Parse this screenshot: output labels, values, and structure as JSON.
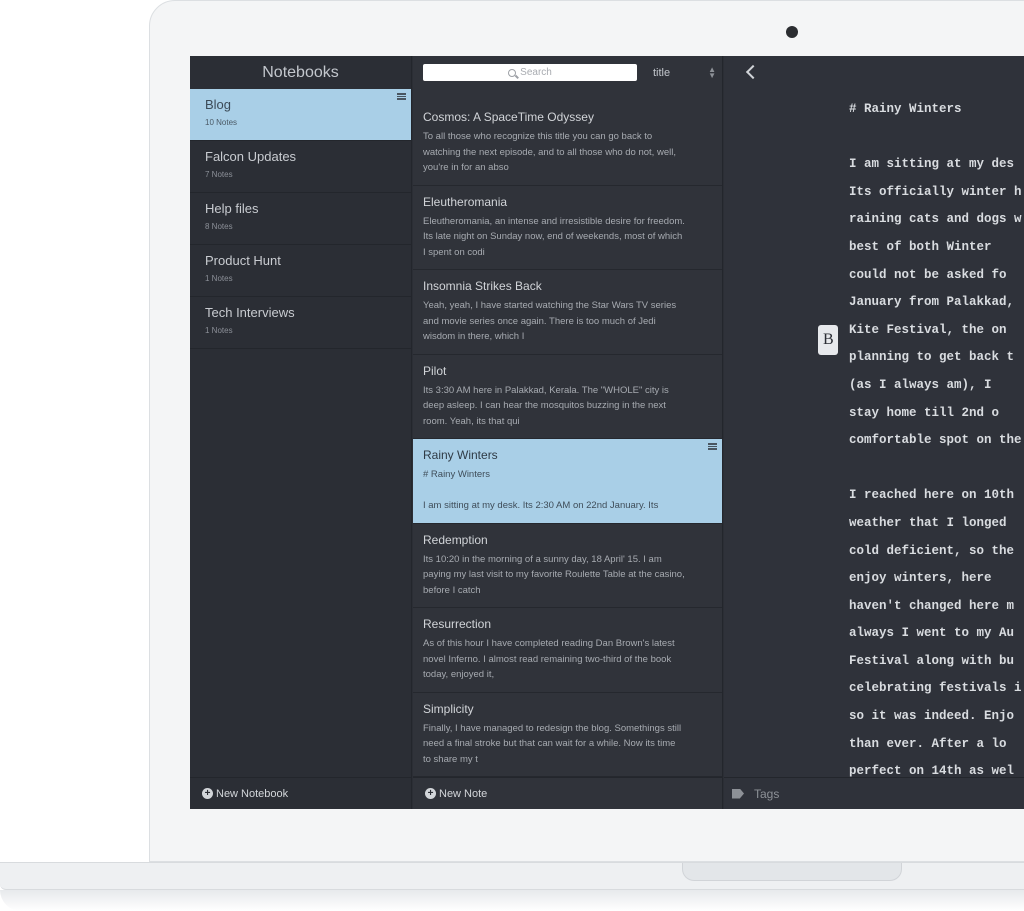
{
  "notebooks": {
    "header": "Notebooks",
    "items": [
      {
        "name": "Blog",
        "count": "10 Notes",
        "active": true
      },
      {
        "name": "Falcon Updates",
        "count": "7 Notes",
        "active": false
      },
      {
        "name": "Help files",
        "count": "8 Notes",
        "active": false
      },
      {
        "name": "Product Hunt",
        "count": "1 Notes",
        "active": false
      },
      {
        "name": "Tech Interviews",
        "count": "1 Notes",
        "active": false
      }
    ],
    "footer": "New Notebook"
  },
  "notes": {
    "search_placeholder": "Search",
    "sort_label": "title",
    "items": [
      {
        "title": "Cosmos: A SpaceTime Odyssey",
        "excerpt": "To all those who recognize this title you can go back to\nwatching the next episode, and to all those who do not, well,\nyou're in for an abso",
        "active": false
      },
      {
        "title": "Eleutheromania",
        "excerpt": "Eleutheromania, an intense and irresistible desire for freedom.\nIts late night on Sunday now, end of weekends, most of which\nI spent on codi",
        "active": false
      },
      {
        "title": "Insomnia Strikes Back",
        "excerpt": "Yeah, yeah, I have started watching the Star Wars TV series\nand movie series once again. There is too much of Jedi\nwisdom in there, which I",
        "active": false
      },
      {
        "title": "Pilot",
        "excerpt": "Its 3:30 AM here in Palakkad, Kerala. The \"WHOLE\" city is\ndeep asleep. I can hear the mosquitos buzzing in the next\nroom. Yeah, its that qui",
        "active": false
      },
      {
        "title": "Rainy Winters",
        "excerpt": "# Rainy Winters\n\nI am sitting at my desk. Its 2:30 AM on 22nd January. Its",
        "active": true
      },
      {
        "title": "Redemption",
        "excerpt": "Its 10:20 in the morning of a sunny day, 18 April' 15. I am\npaying my last visit to my favorite Roulette Table at the casino,\nbefore I catch",
        "active": false
      },
      {
        "title": "Resurrection",
        "excerpt": "As of this hour I have completed reading Dan Brown's latest\nnovel Inferno. I almost read remaining two-third of the book\ntoday, enjoyed it,",
        "active": false
      },
      {
        "title": "Simplicity",
        "excerpt": "Finally, I have managed to redesign the blog. Somethings still\nneed a final stroke but that can wait for a while. Now its time\nto share my t",
        "active": false
      }
    ],
    "footer": "New Note"
  },
  "editor": {
    "lines": [
      "# Rainy Winters",
      "",
      "I am sitting at my des",
      "Its officially winter h",
      "raining cats and dogs w",
      "best of both Winter",
      "could not be asked fo",
      "January from Palakkad,",
      "Kite Festival, the on",
      "planning to get back t",
      "(as I always am), I",
      "stay home till 2nd o",
      "comfortable spot on the",
      "",
      "I reached here on 10th",
      "weather that I longed",
      "cold deficient, so the",
      "enjoy winters, here",
      "haven't changed here m",
      "always I went to my Au",
      "Festival along with bu",
      "celebrating festivals i",
      "so it was indeed. Enjo",
      "than ever. After a lo",
      "perfect on 14th as wel"
    ],
    "floating_button": "B",
    "tags_label": "Tags"
  }
}
